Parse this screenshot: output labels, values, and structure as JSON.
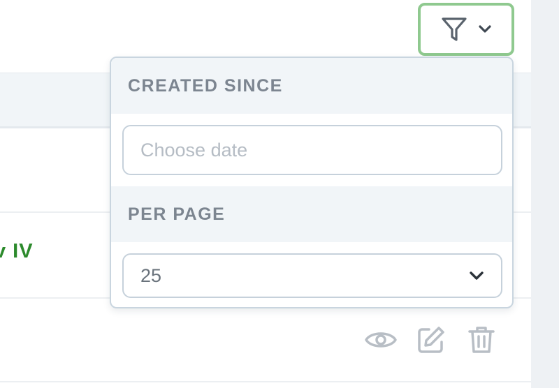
{
  "table": {
    "row_link_text": "v IV"
  },
  "row_actions": {
    "view_icon": "eye-icon",
    "edit_icon": "edit-icon",
    "delete_icon": "trash-icon"
  },
  "filter_button": {
    "icon": "filter-icon",
    "caret_icon": "chevron-down-icon",
    "accent_color": "#8fc98f"
  },
  "filter_dropdown": {
    "created_since": {
      "label": "CREATED SINCE",
      "placeholder": "Choose date",
      "value": ""
    },
    "per_page": {
      "label": "PER PAGE",
      "selected": "25",
      "caret_icon": "chevron-down-icon"
    }
  },
  "colors": {
    "link_green": "#2c8a2c",
    "section_bg": "#f1f5f8",
    "muted_text": "#7c8590"
  }
}
